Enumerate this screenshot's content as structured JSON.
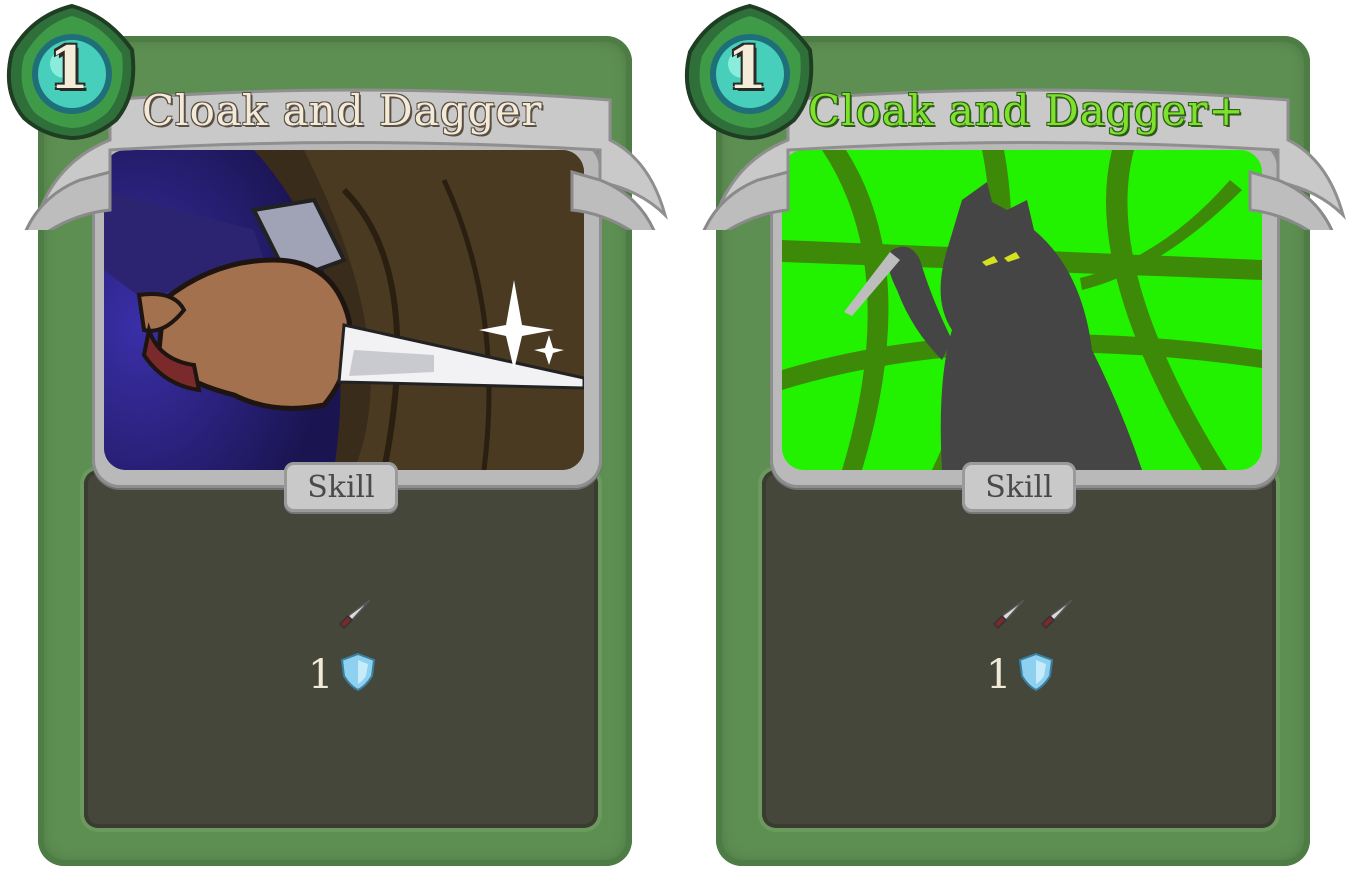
{
  "cards": [
    {
      "id": "base",
      "cost": "1",
      "title": "Cloak and Dagger",
      "type": "Skill",
      "description": {
        "dagger_icons": [
          "dagger-icon"
        ],
        "block_value": "1",
        "block_icon": "block-shield-icon"
      },
      "art": "hand-holding-dagger",
      "title_color": "#f4ead8"
    },
    {
      "id": "upgraded",
      "cost": "1",
      "title": "Cloak and Dagger+",
      "type": "Skill",
      "description": {
        "dagger_icons": [
          "dagger-icon",
          "dagger-icon"
        ],
        "block_value": "1",
        "block_icon": "block-shield-icon"
      },
      "art": "silhouette-with-dagger",
      "title_color": "#7de22d"
    }
  ],
  "colors": {
    "card_frame": "#5d8f52",
    "description_panel": "#45473a",
    "energy_orb": "#4fe0c8",
    "upgrade_highlight": "#22f200"
  }
}
